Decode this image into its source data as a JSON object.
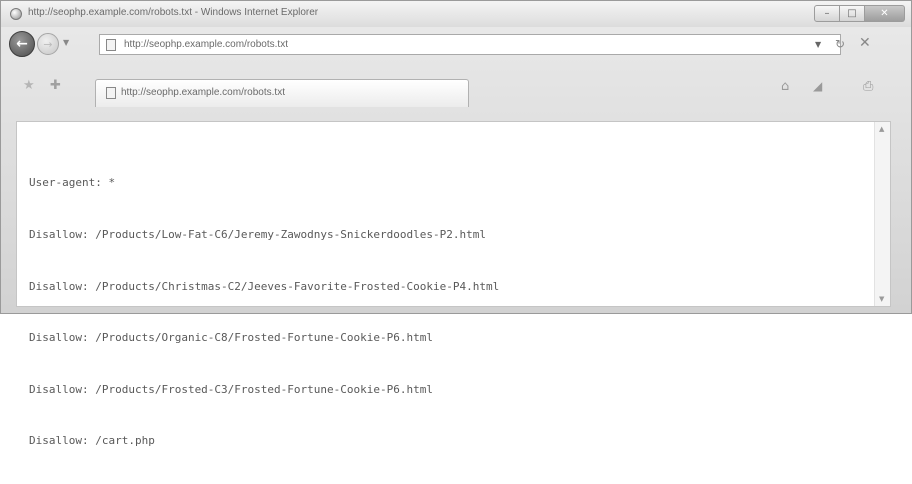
{
  "window": {
    "title": "http://seophp.example.com/robots.txt - Windows Internet Explorer",
    "minimize_icon": "minimize-icon",
    "maximize_icon": "maximize-icon",
    "close_icon": "close-icon"
  },
  "nav": {
    "back_icon": "back-arrow-icon",
    "forward_icon": "forward-arrow-icon",
    "address": "http://seophp.example.com/robots.txt",
    "refresh_icon": "refresh-icon",
    "stop_icon": "stop-icon"
  },
  "tab": {
    "title": "http://seophp.example.com/robots.txt"
  },
  "content": {
    "lines": [
      "User-agent: *",
      "Disallow: /Products/Low-Fat-C6/Jeremy-Zawodnys-Snickerdoodles-P2.html",
      "Disallow: /Products/Christmas-C2/Jeeves-Favorite-Frosted-Cookie-P4.html",
      "Disallow: /Products/Organic-C8/Frosted-Fortune-Cookie-P6.html",
      "Disallow: /Products/Frosted-C3/Frosted-Fortune-Cookie-P6.html",
      "Disallow: /cart.php"
    ]
  },
  "colors": {
    "chrome": "#d9d9d9",
    "content_bg": "#ffffff",
    "text": "#595959"
  }
}
